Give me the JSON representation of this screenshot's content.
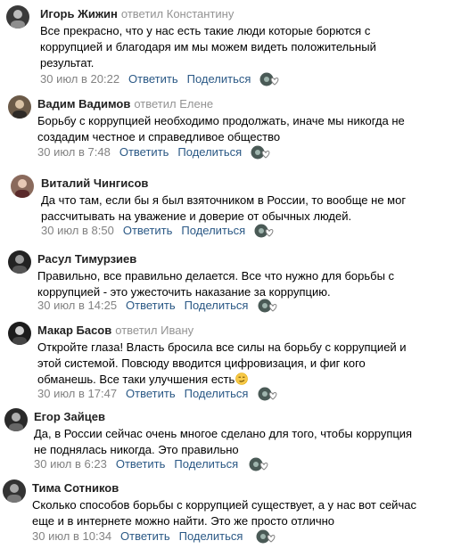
{
  "actions": {
    "reply": "Ответить",
    "share": "Поделиться"
  },
  "icons": {
    "likes_icon": "reaction-avatar-heart-icon",
    "emoji": "smirk-emoji"
  },
  "colors": {
    "link": "#2a5885",
    "meta": "#828282",
    "reply_to": "#939393"
  },
  "comments": [
    {
      "author": "Игорь Жижин",
      "reply_to": "ответил Константину",
      "lines": [
        "Все прекрасно, что у нас есть такие люди которые борются с",
        "коррупцией и благодаря им мы можем видеть положительный",
        "результат."
      ],
      "date": "30 июл в 20:22"
    },
    {
      "author": "Вадим Вадимов",
      "reply_to": "ответил Елене",
      "lines": [
        "Борьбу с коррупцией необходимо продолжать, иначе мы никогда не",
        "создадим честное и справедливое общество"
      ],
      "date": "30 июл в 7:48"
    },
    {
      "author": "Виталий Чингисов",
      "reply_to": "",
      "lines": [
        "Да что там, если бы я был взяточником в России, то вообще не мог",
        "рассчитывать на уважение и доверие от обычных людей."
      ],
      "date": "30 июл в 8:50"
    },
    {
      "author": "Расул Тимурзиев",
      "reply_to": "",
      "lines": [
        "Правильно, все правильно делается. Все что нужно для борьбы с",
        "коррупцией - это ужесточить наказание за коррупцию."
      ],
      "date": "30 июл в 14:25"
    },
    {
      "author": "Макар Басов",
      "reply_to": "ответил Ивану",
      "lines": [
        "Откройте глаза! Власть бросила все силы на борьбу с коррупцией и",
        "этой системой. Повсюду вводится цифровизация, и фиг кого",
        "обманешь. Все таки улучшения есть"
      ],
      "date": "30 июл в 17:47"
    },
    {
      "author": "Егор Зайцев",
      "reply_to": "",
      "lines": [
        "Да, в России сейчас очень многое сделано для того, чтобы коррупция",
        "не поднялась никогда. Это правильно"
      ],
      "date": "30 июл в 6:23"
    },
    {
      "author": "Тима Сотников",
      "reply_to": "",
      "lines": [
        "Сколько способов борьбы с коррупцией существует, а у нас вот сейчас",
        "еще и в интернете можно найти. Это же просто отлично"
      ],
      "date": "30 июл в 10:34"
    }
  ]
}
